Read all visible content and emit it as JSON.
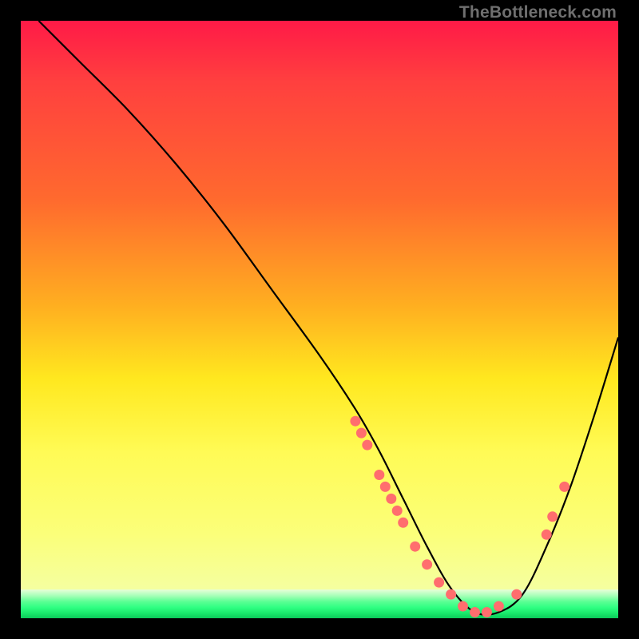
{
  "watermark": "TheBottleneck.com",
  "chart_data": {
    "type": "line",
    "title": "",
    "xlabel": "",
    "ylabel": "",
    "xlim": [
      0,
      100
    ],
    "ylim": [
      0,
      100
    ],
    "series": [
      {
        "name": "curve",
        "x": [
          3,
          10,
          18,
          26,
          34,
          42,
          50,
          56,
          60,
          64,
          68,
          72,
          76,
          80,
          84,
          88,
          92,
          96,
          100
        ],
        "y": [
          100,
          93,
          85,
          76,
          66,
          55,
          44,
          35,
          28,
          20,
          12,
          5,
          1,
          1,
          4,
          12,
          22,
          34,
          47
        ]
      }
    ],
    "markers": [
      {
        "x": 56,
        "y": 33
      },
      {
        "x": 57,
        "y": 31
      },
      {
        "x": 58,
        "y": 29
      },
      {
        "x": 60,
        "y": 24
      },
      {
        "x": 61,
        "y": 22
      },
      {
        "x": 62,
        "y": 20
      },
      {
        "x": 63,
        "y": 18
      },
      {
        "x": 64,
        "y": 16
      },
      {
        "x": 66,
        "y": 12
      },
      {
        "x": 68,
        "y": 9
      },
      {
        "x": 70,
        "y": 6
      },
      {
        "x": 72,
        "y": 4
      },
      {
        "x": 74,
        "y": 2
      },
      {
        "x": 76,
        "y": 1
      },
      {
        "x": 78,
        "y": 1
      },
      {
        "x": 80,
        "y": 2
      },
      {
        "x": 83,
        "y": 4
      },
      {
        "x": 88,
        "y": 14
      },
      {
        "x": 89,
        "y": 17
      },
      {
        "x": 91,
        "y": 22
      }
    ],
    "marker_color": "#ff6e6e",
    "curve_color": "#000000"
  }
}
